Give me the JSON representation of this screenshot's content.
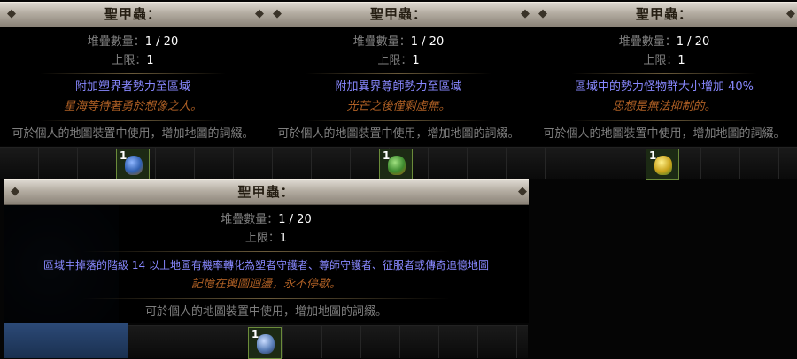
{
  "tooltips": [
    {
      "title": "聖甲蟲：",
      "stack_label": "堆疊數量：",
      "stack_value": "1 / 20",
      "limit_label": "上限：",
      "limit_value": "1",
      "mod": "附加塑界者勢力至區域",
      "flavor": "星海等待著勇於想像之人。",
      "help": "可於個人的地圖裝置中使用，增加地圖的詞綴。",
      "slot_qty": "1"
    },
    {
      "title": "聖甲蟲：",
      "stack_label": "堆疊數量：",
      "stack_value": "1 / 20",
      "limit_label": "上限：",
      "limit_value": "1",
      "mod": "附加異界尊師勢力至區域",
      "flavor": "光芒之後僅剩虛無。",
      "help": "可於個人的地圖裝置中使用，增加地圖的詞綴。",
      "slot_qty": "1"
    },
    {
      "title": "聖甲蟲：",
      "stack_label": "堆疊數量：",
      "stack_value": "1 / 20",
      "limit_label": "上限：",
      "limit_value": "1",
      "mod": "區域中的勢力怪物群大小增加 40%",
      "flavor": "思想是無法抑制的。",
      "help": "可於個人的地圖裝置中使用，增加地圖的詞綴。",
      "slot_qty": "1"
    },
    {
      "title": "聖甲蟲：",
      "stack_label": "堆疊數量：",
      "stack_value": "1 / 20",
      "limit_label": "上限：",
      "limit_value": "1",
      "mod": "區域中掉落的階級 14 以上地圖有機率轉化為塑者守護者、尊師守護者、征服者或傳奇追憶地圖",
      "flavor": "記憶在輿圖迴盪，永不停歇。",
      "help": "可於個人的地圖裝置中使用，增加地圖的詞綴。",
      "slot_qty": "1"
    }
  ],
  "colors": {
    "title": "#241d12",
    "label": "#7f7f7f",
    "value": "#ffffff",
    "mod": "#8888ff",
    "flavor": "#af6025",
    "scarab_1": "#2f5fb0",
    "scarab_2": "#3c8a2e",
    "scarab_3": "#c9a21a",
    "scarab_4": "#5a7fb8"
  },
  "icons": {
    "header_ornament": "ornament-icon",
    "item": "scarab-icon"
  }
}
